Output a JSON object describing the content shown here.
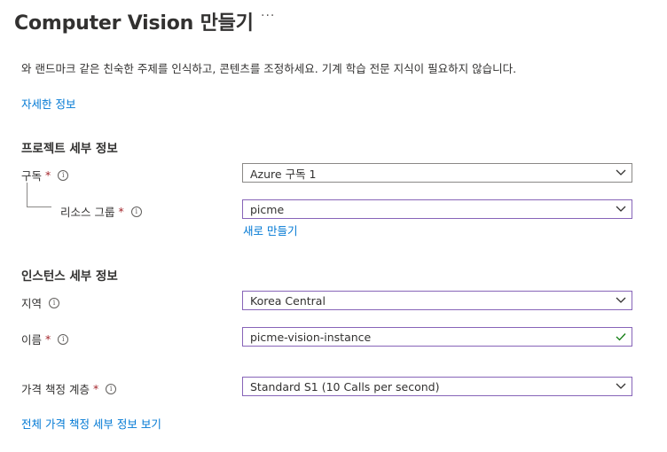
{
  "header": {
    "title": "Computer Vision 만들기",
    "more_label": "···"
  },
  "description": "와 랜드마크 같은 친숙한 주제를 인식하고, 콘텐츠를 조정하세요. 기계 학습 전문 지식이 필요하지 않습니다.",
  "learn_more_link": "자세한 정보",
  "project_details": {
    "heading": "프로젝트 세부 정보",
    "subscription": {
      "label": "구독",
      "required": "*",
      "value": "Azure 구독 1"
    },
    "resource_group": {
      "label": "리소스 그룹",
      "required": "*",
      "value": "picme",
      "create_new_link": "새로 만들기"
    }
  },
  "instance_details": {
    "heading": "인스턴스 세부 정보",
    "region": {
      "label": "지역",
      "value": "Korea Central"
    },
    "name": {
      "label": "이름",
      "required": "*",
      "value": "picme-vision-instance"
    },
    "pricing_tier": {
      "label": "가격 책정 계층",
      "required": "*",
      "value": "Standard S1 (10 Calls per second)"
    }
  },
  "view_pricing_link": "전체 가격 책정 세부 정보 보기",
  "icons": {
    "info": "i",
    "dropdown": "chevron-down-icon",
    "valid": "checkmark-icon"
  },
  "colors": {
    "link": "#0078d4",
    "required": "#a4262c",
    "focus_border": "#8764b8",
    "valid_check": "#107c10"
  }
}
